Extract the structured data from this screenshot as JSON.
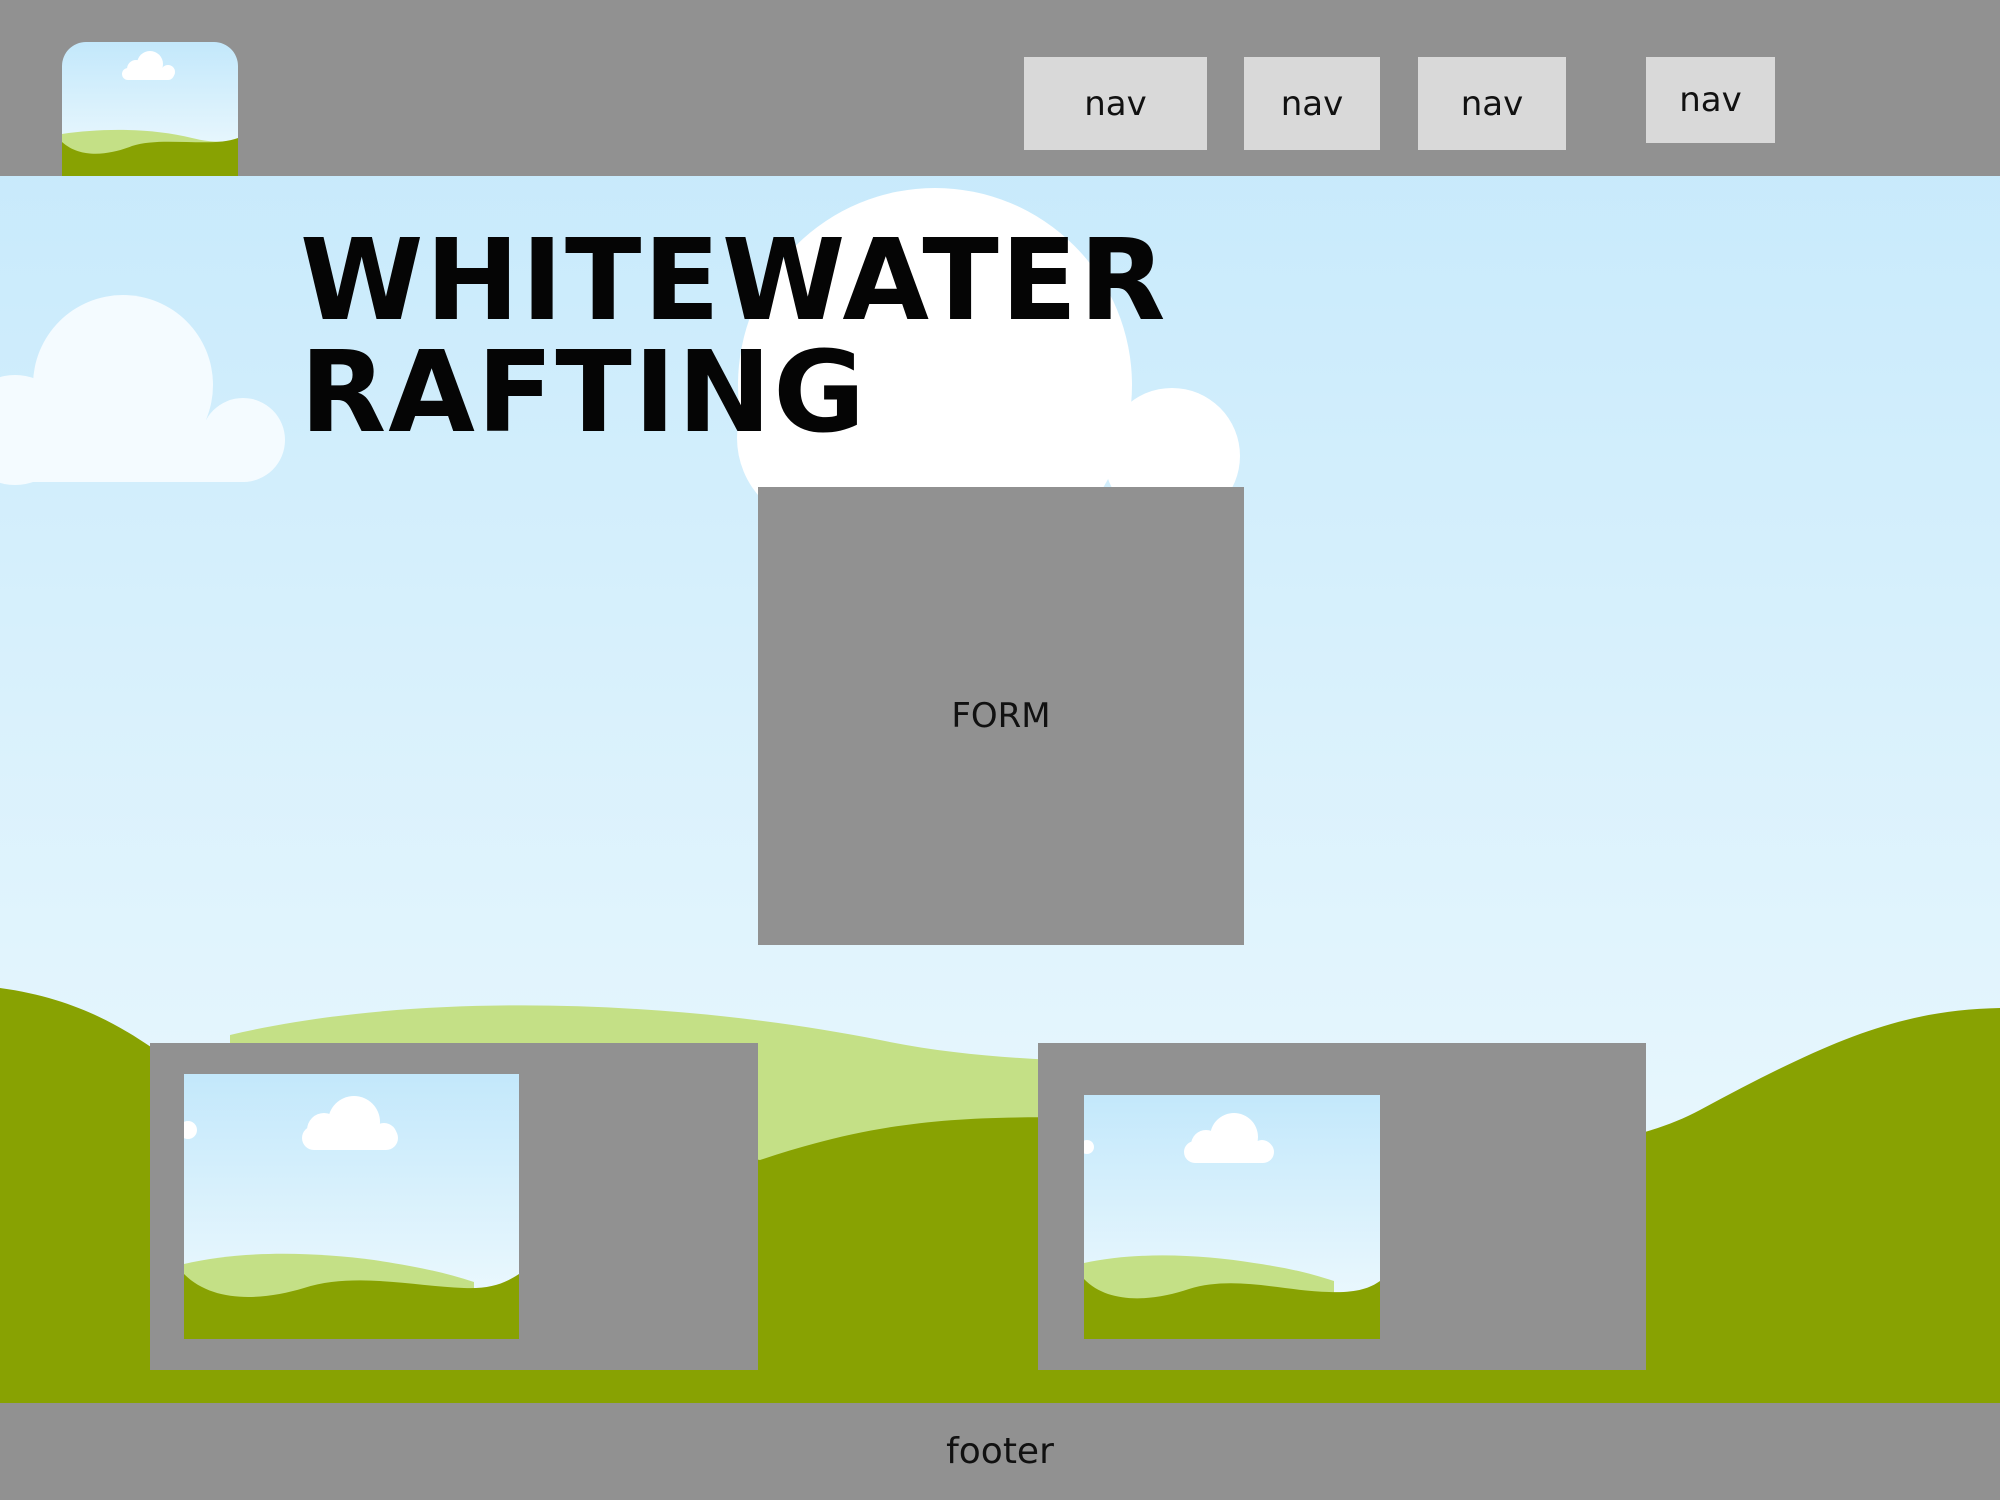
{
  "header": {
    "nav": [
      {
        "label": "nav"
      },
      {
        "label": "nav"
      },
      {
        "label": "nav"
      },
      {
        "label": "nav"
      }
    ]
  },
  "hero": {
    "title": "WHITEWATER RAFTING"
  },
  "form": {
    "label": "FORM"
  },
  "footer": {
    "label": "footer"
  },
  "colors": {
    "placeholder_gray": "#919191",
    "nav_bg": "#d9d9d9",
    "sky_top": "#c3e8fb",
    "sky_bottom": "#f2fbfe",
    "hill_light": "#c4e086",
    "hill_dark": "#88a202"
  }
}
